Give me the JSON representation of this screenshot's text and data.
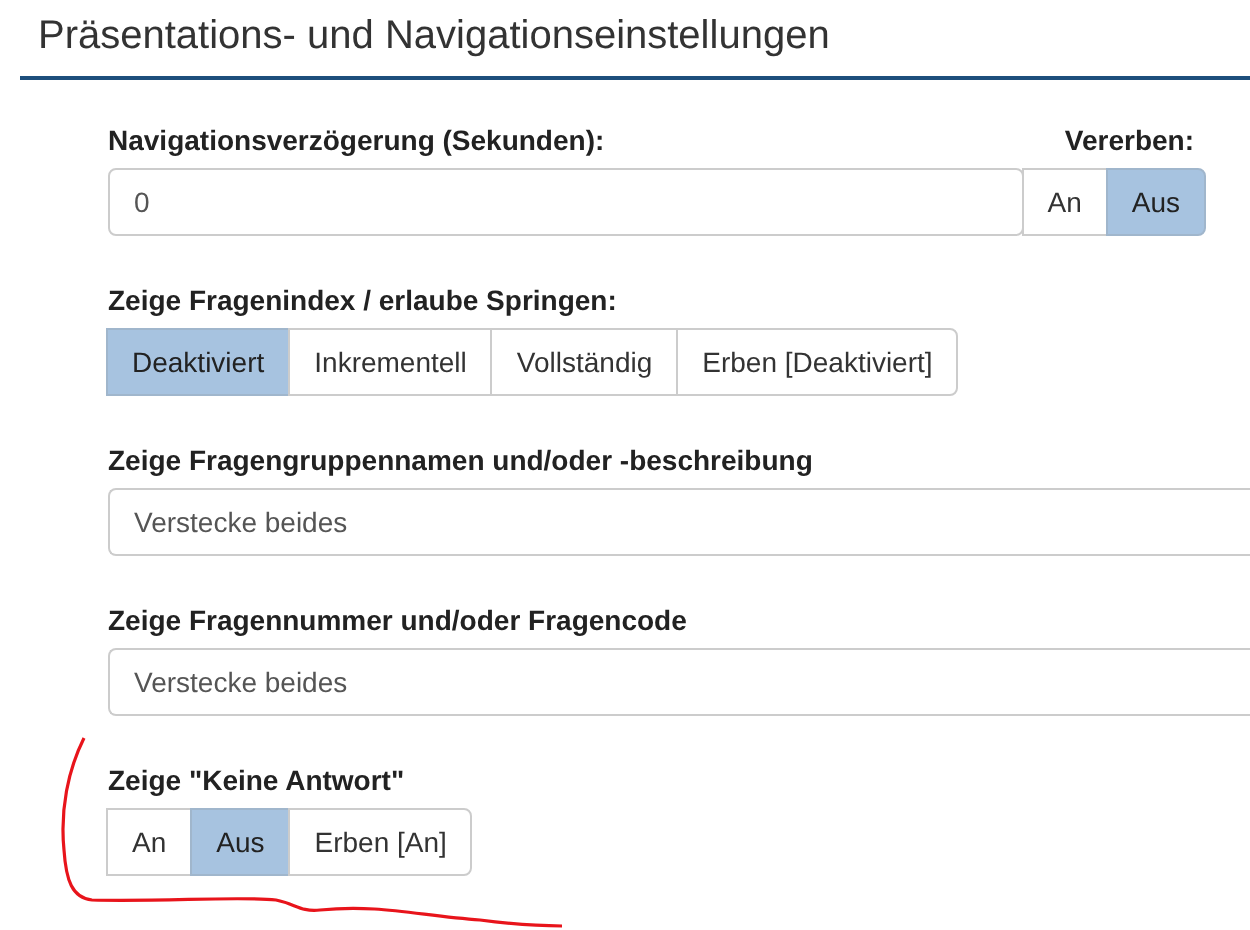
{
  "title": "Präsentations- und Navigationseinstellungen",
  "fields": [
    {
      "kind": "number",
      "label": "Navigationsverzögerung (Sekunden):",
      "value": "0",
      "inherit": {
        "label": "Vererben:",
        "options": [
          {
            "label": "An",
            "selected": false
          },
          {
            "label": "Aus",
            "selected": true
          }
        ]
      }
    },
    {
      "kind": "buttons",
      "label": "Zeige Fragenindex / erlaube Springen:",
      "options": [
        {
          "label": "Deaktiviert",
          "selected": true
        },
        {
          "label": "Inkrementell",
          "selected": false
        },
        {
          "label": "Vollständig",
          "selected": false
        },
        {
          "label": "Erben [Deaktiviert]",
          "selected": false
        }
      ]
    },
    {
      "kind": "select",
      "label": "Zeige Fragengruppennamen und/oder -beschreibung",
      "value": "Verstecke beides"
    },
    {
      "kind": "select",
      "label": "Zeige Fragennummer und/oder Fragencode",
      "value": "Verstecke beides"
    },
    {
      "kind": "buttons",
      "label": "Zeige \"Keine Antwort\"",
      "options": [
        {
          "label": "An",
          "selected": false
        },
        {
          "label": "Aus",
          "selected": true
        },
        {
          "label": "Erben [An]",
          "selected": false
        }
      ]
    }
  ],
  "annotation": {
    "kind": "freehand"
  }
}
